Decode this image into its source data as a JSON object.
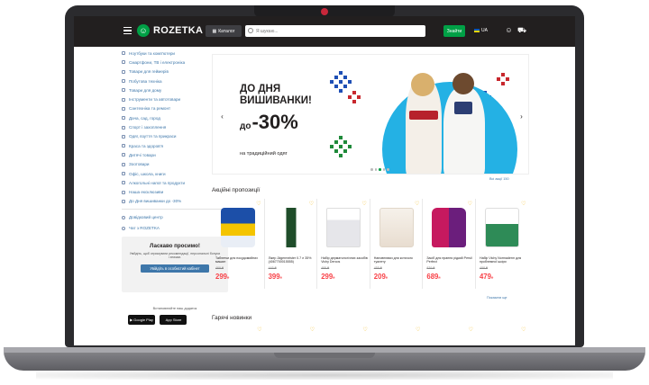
{
  "header": {
    "logo_text": "ROZETKA",
    "catalog_label": "Каталог",
    "search_placeholder": "Я шукаю...",
    "search_button": "Знайти",
    "lang": "UA"
  },
  "sidebar": {
    "categories": [
      "Ноутбуки та комп'ютери",
      "Смартфони, ТВ і електроніка",
      "Товари для геймерів",
      "Побутова техніка",
      "Товари для дому",
      "Інструменти та автотовари",
      "Сантехніка та ремонт",
      "Дача, сад, город",
      "Спорт і захоплення",
      "Одяг, взуття та прикраси",
      "Краса та здоров'я",
      "Дитячі товари",
      "Зоотовари",
      "Офіс, школа, книги",
      "Алкогольні напої та продукти",
      "Наша ексклюзиви",
      "До Дня вишиванки до -30%"
    ],
    "services": [
      "Довідковий центр",
      "Чат з ROZETKA",
      "Інше видно Rozetka"
    ],
    "promo": {
      "title": "Ласкаво просимо!",
      "text": "Увійдіть, щоб отримувати рекомендації, персональні бонуси і знижки.",
      "button": "Увійдіть в особистий кабінет"
    },
    "apps_label": "Встановлюйте наш додаток",
    "google_play": "Google Play",
    "app_store": "App Store"
  },
  "banner": {
    "title_line1": "ДО ДНЯ",
    "title_line2": "ВИШИВАНКИ!",
    "discount_prefix": "до",
    "discount": "-30%",
    "subtitle": "на традиційний одяг",
    "all_promos": "Всі акції 150"
  },
  "sections": {
    "promo_title": "Акційні пропозиції",
    "hot_title": "Гарячі новинки",
    "show_more": "Показати ще"
  },
  "products": [
    {
      "name": "Таблетки для посудомийних машин",
      "old_price": "469 ₴",
      "price": "299",
      "currency": "₴"
    },
    {
      "name": "Лікер Jägermeister 0.7 л 35% (4067700015555)",
      "old_price": "445 ₴",
      "price": "399",
      "currency": "₴"
    },
    {
      "name": "Набір дерматологічних засобів Vichy Dercos",
      "old_price": "489 ₴",
      "price": "299",
      "currency": "₴"
    },
    {
      "name": "Наповнювач для котячого туалету",
      "old_price": "455 ₴",
      "price": "209",
      "currency": "₴"
    },
    {
      "name": "Засіб для прання рідкий Persil Perfect",
      "old_price": "839 ₴",
      "price": "689",
      "currency": "₴"
    },
    {
      "name": "Набір Vichy Normaderm для проблемної шкіри",
      "old_price": "488 ₴",
      "price": "479",
      "currency": "₴"
    }
  ],
  "colors": {
    "header_bg": "#221f1f",
    "brand_green": "#00a046",
    "price_red": "#f84147",
    "link_blue": "#3e77aa",
    "banner_blue": "#24b1e4"
  }
}
